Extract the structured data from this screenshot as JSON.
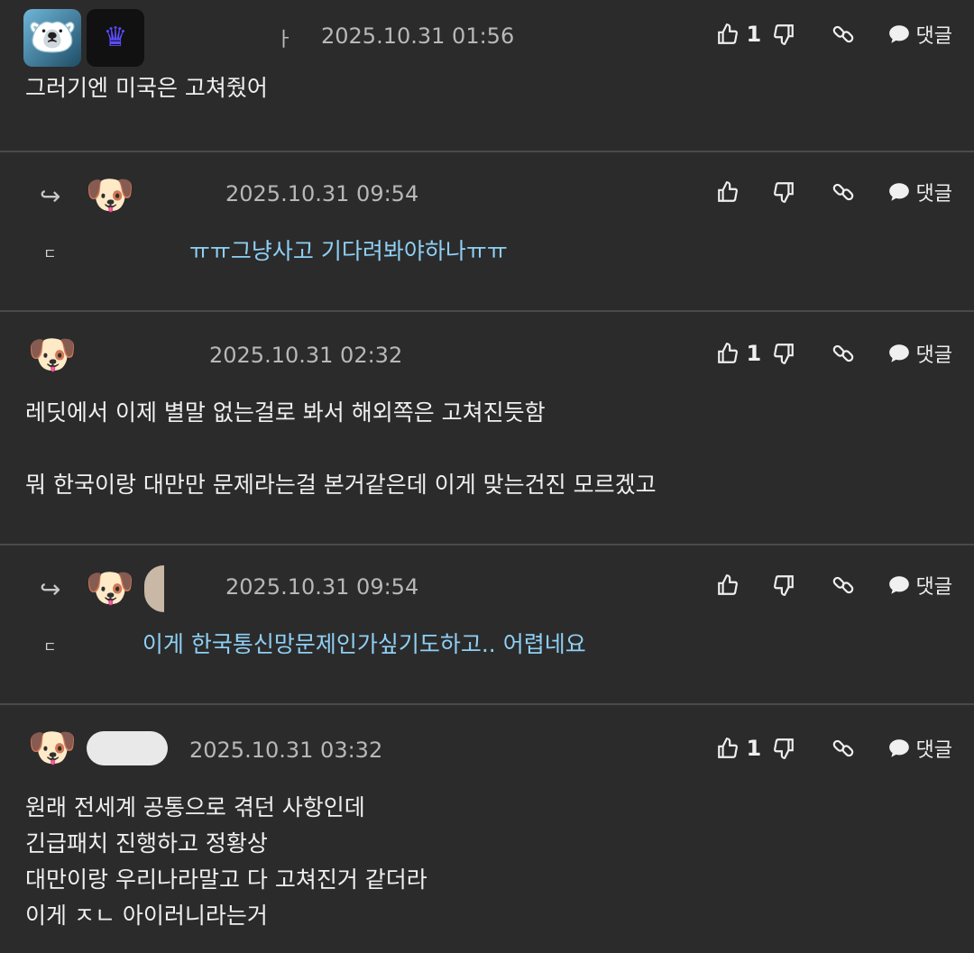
{
  "comments": [
    {
      "nick": "ㅏ",
      "date": "2025.10.31 01:56",
      "likes": "1",
      "reply_label": "댓글",
      "lines": [
        "그러기엔 미국은 고쳐줬어"
      ]
    },
    {
      "nick": "",
      "date": "2025.10.31 09:54",
      "likes": "",
      "reply_label": "댓글",
      "mention": "ㄷ",
      "text": "ㅠㅠ그냥사고 기다려봐야하나ㅠㅠ"
    },
    {
      "nick": "",
      "date": "2025.10.31 02:32",
      "likes": "1",
      "reply_label": "댓글",
      "lines": [
        "레딧에서 이제 별말 없는걸로 봐서 해외쪽은 고쳐진듯함",
        "",
        "뭐 한국이랑 대만만 문제라는걸 본거같은데 이게 맞는건진 모르겠고"
      ]
    },
    {
      "nick": "",
      "date": "2025.10.31 09:54",
      "likes": "",
      "reply_label": "댓글",
      "mention": "ㄷ",
      "text": "이게 한국통신망문제인가싶기도하고.. 어렵네요"
    },
    {
      "nick": "",
      "date": "2025.10.31 03:32",
      "likes": "1",
      "reply_label": "댓글",
      "lines": [
        "원래 전세계 공통으로 겪던 사항인데",
        "긴급패치 진행하고 정황상",
        "대만이랑 우리나라말고 다 고쳐진거 같더라",
        "이게 ㅈㄴ 아이러니라는거"
      ]
    }
  ],
  "icons": {
    "like": "thumbs-up-icon",
    "dislike": "thumbs-down-icon",
    "link": "link-icon",
    "reply": "speech-bubble-icon",
    "reply_arrow": "reply-arrow-icon"
  },
  "colors": {
    "background": "#2b2b2b",
    "divider": "#4a4a4a",
    "reply_text": "#8fd0f5"
  }
}
